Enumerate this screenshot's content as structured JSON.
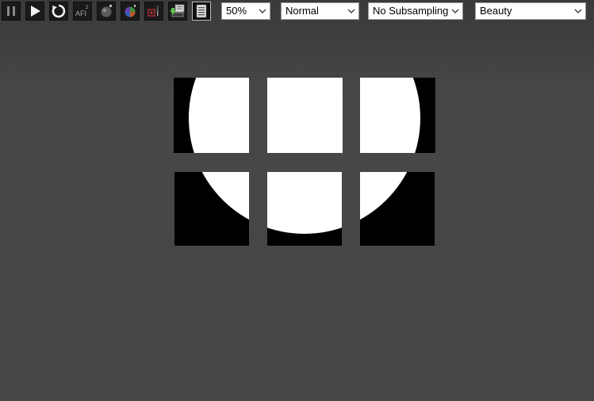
{
  "toolbar": {
    "buttons": [
      {
        "name": "pause-icon"
      },
      {
        "name": "play-icon"
      },
      {
        "name": "refresh-icon"
      },
      {
        "name": "afi-icon",
        "text": "AFI",
        "sup": "2"
      },
      {
        "name": "render-ball-icon"
      },
      {
        "name": "color-sphere-icon"
      },
      {
        "name": "region-icon",
        "sup": "2"
      },
      {
        "name": "import-icon"
      },
      {
        "name": "document-icon"
      }
    ],
    "zoom": {
      "value": "50%"
    },
    "mode": {
      "value": "Normal"
    },
    "subsampling": {
      "value": "No Subsampling"
    },
    "pass": {
      "value": "Beauty"
    }
  },
  "viewer": {
    "background": "#454545",
    "tile_fill": "#ffffff",
    "tile_bg": "#000000",
    "grid": {
      "rows": 2,
      "cols": 3
    }
  }
}
